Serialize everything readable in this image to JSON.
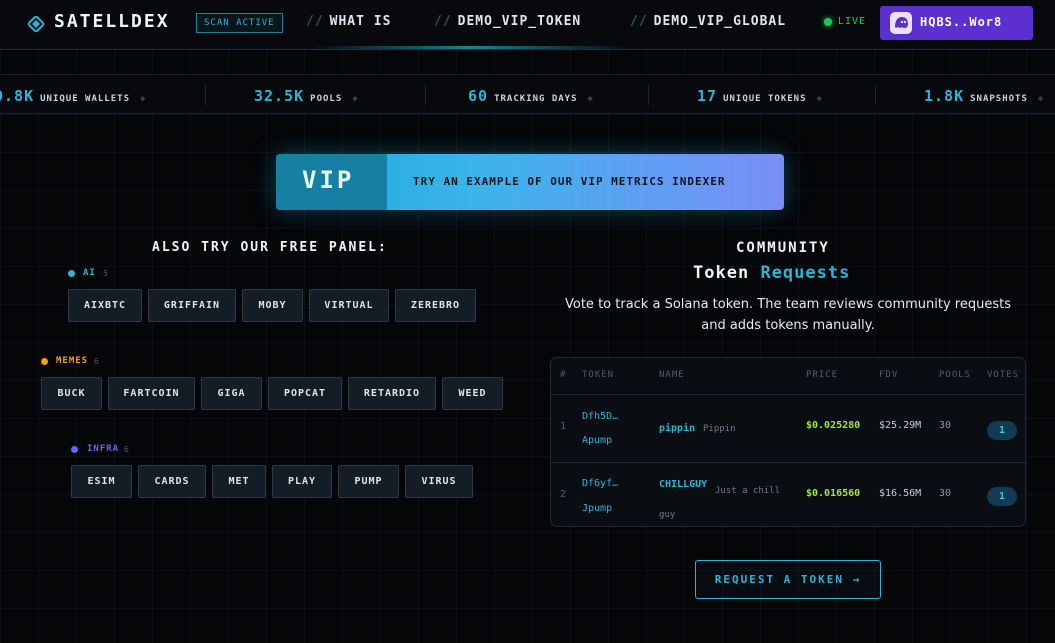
{
  "header": {
    "logo": "SATELLDEX",
    "scan_badge": "SCAN ACTIVE",
    "nav": [
      {
        "label": "WHAT IS"
      },
      {
        "label": "DEMO_VIP_TOKEN"
      },
      {
        "label": "DEMO_VIP_GLOBAL"
      }
    ],
    "nav_prefix": "//",
    "live": "LIVE",
    "wallet": "HQBS..Wor8"
  },
  "stats": [
    {
      "value": "0.8K",
      "label": "UNIQUE WALLETS"
    },
    {
      "value": "32.5K",
      "label": "POOLS"
    },
    {
      "value": "60",
      "label": "TRACKING DAYS"
    },
    {
      "value": "17",
      "label": "UNIQUE TOKENS"
    },
    {
      "value": "1.8K",
      "label": "SNAPSHOTS"
    }
  ],
  "vip": {
    "badge": "VIP",
    "text": "TRY AN EXAMPLE OF OUR VIP METRICS INDEXER"
  },
  "free_panel": {
    "title": "ALSO TRY OUR FREE PANEL:",
    "categories": [
      {
        "label": "AI",
        "count": "5",
        "tokens": [
          "AIXBTC",
          "GRIFFAIN",
          "MOBY",
          "VIRTUAL",
          "ZEREBRO"
        ]
      },
      {
        "label": "MEMES",
        "count": "6",
        "tokens": [
          "BUCK",
          "FARTCOIN",
          "GIGA",
          "POPCAT",
          "RETARDIO",
          "WEED"
        ]
      },
      {
        "label": "INFRA",
        "count": "6",
        "tokens": [
          "ESIM",
          "CARDS",
          "MET",
          "PLAY",
          "PUMP",
          "VIRUS"
        ]
      }
    ]
  },
  "community": {
    "title": "COMMUNITY",
    "subtitle_a": "Token",
    "subtitle_b": "Requests",
    "description": "Vote to track a Solana token. The team reviews community requests and adds tokens manually.",
    "columns": [
      "#",
      "TOKEN",
      "NAME",
      "PRICE",
      "FDV",
      "POOLS",
      "VOTES"
    ],
    "rows": [
      {
        "idx": "1",
        "addr1": "Dfh5D…",
        "addr2": "Apump",
        "name": "pippin",
        "desc": "Pippin",
        "price": "$0.025280",
        "fdv": "$25.29M",
        "pools": "30",
        "votes": "1"
      },
      {
        "idx": "2",
        "addr1": "Df6yf…",
        "addr2": "Jpump",
        "name": "CHILLGUY",
        "desc": "Just a chill guy",
        "price": "$0.016560",
        "fdv": "$16.56M",
        "pools": "30",
        "votes": "1"
      }
    ],
    "request_button": "REQUEST A TOKEN →"
  },
  "colors": {
    "accent": "#2ab4d6",
    "wallet": "#5b2fd0",
    "live": "#22c55e",
    "ai": "#2ab4d6",
    "memes": "#f59e0b",
    "infra": "#6366f1"
  }
}
